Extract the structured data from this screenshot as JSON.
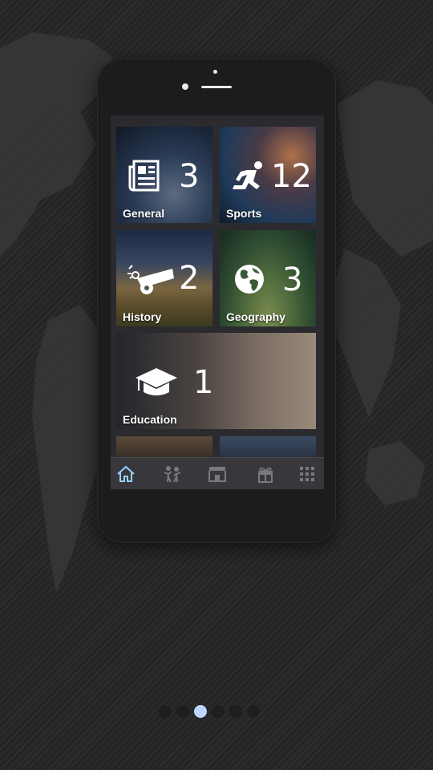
{
  "tiles": [
    {
      "label": "General",
      "count": "3",
      "icon": "newspaper-icon",
      "color": "#2a3b55"
    },
    {
      "label": "Sports",
      "count": "12",
      "icon": "runner-icon",
      "color": "#1f3a5a"
    },
    {
      "label": "History",
      "count": "2",
      "icon": "cannon-icon",
      "color": "#6a5a3a"
    },
    {
      "label": "Geography",
      "count": "3",
      "icon": "globe-icon",
      "color": "#3b5a3a"
    },
    {
      "label": "Education",
      "count": "1",
      "icon": "graduation-cap-icon",
      "color": "#5a5048"
    }
  ],
  "tabbar": {
    "tabs": [
      "home-icon",
      "people-icon",
      "store-icon",
      "gift-icon",
      "grid-icon"
    ],
    "active_color": "#9ad0ff"
  },
  "pagination": {
    "count": 6,
    "active": 2
  }
}
